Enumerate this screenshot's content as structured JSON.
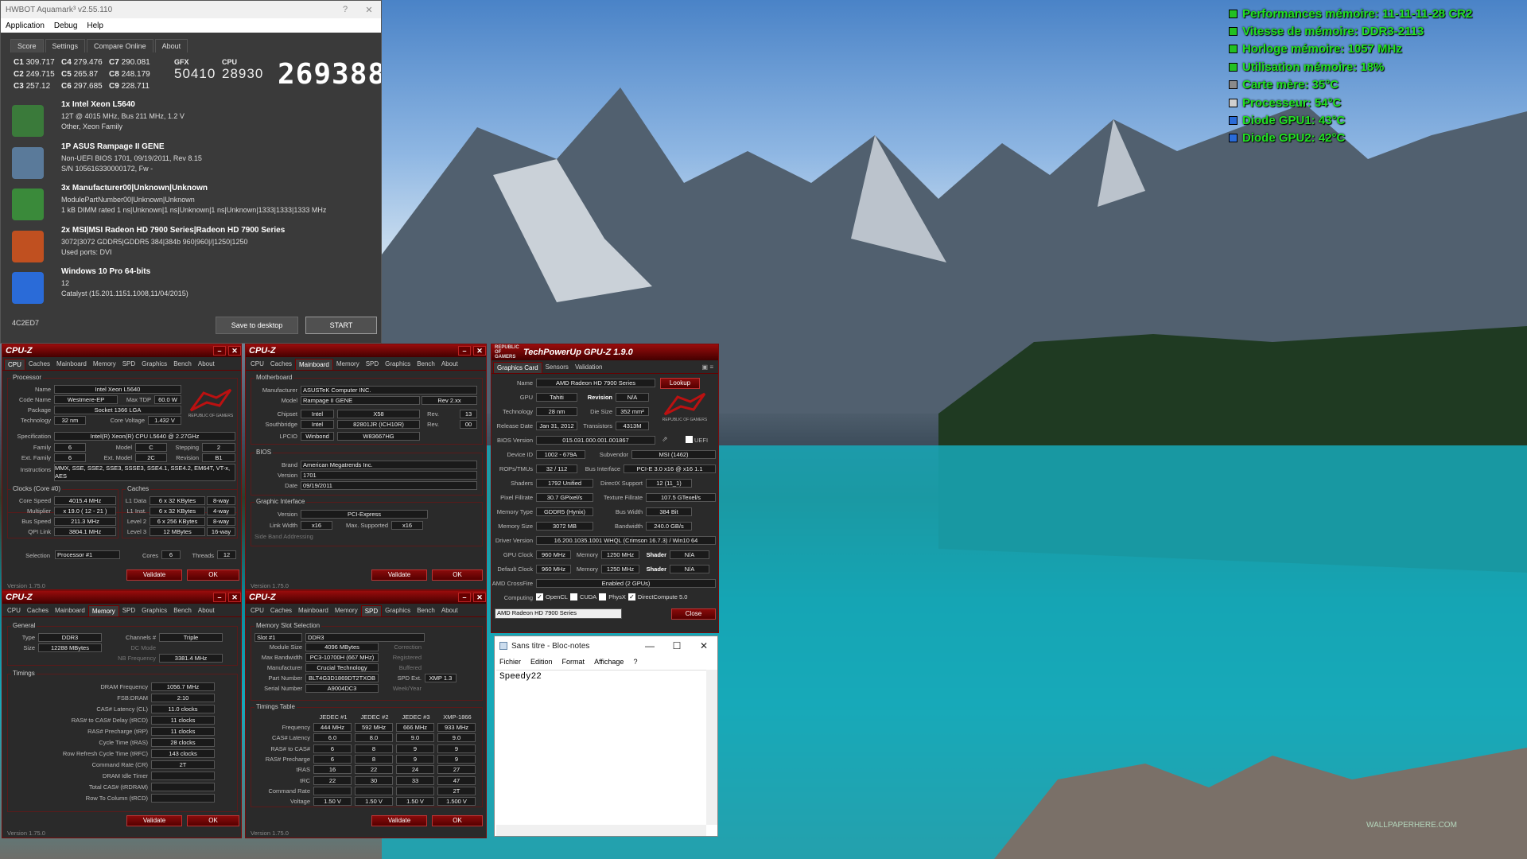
{
  "osd": {
    "lines": [
      {
        "text": "Performances mémoire: 11-11-11-28 CR2",
        "icon_color": "#22c022"
      },
      {
        "text": "Vitesse de mémoire: DDR3-2113",
        "icon_color": "#22c022"
      },
      {
        "text": "Horloge mémoire: 1057 MHz",
        "icon_color": "#22c022"
      },
      {
        "text": "Utilisation mémoire: 18%",
        "icon_color": "#22c022"
      },
      {
        "text": "Carte mère: 35°C",
        "icon_color": "#8a8a8a"
      },
      {
        "text": "Processeur: 54°C",
        "icon_color": "#cfcfcf"
      },
      {
        "text": "Diode GPU1: 43°C",
        "icon_color": "#2a6bd8"
      },
      {
        "text": "Diode GPU2: 42°C",
        "icon_color": "#2a6bd8"
      }
    ]
  },
  "aquamark": {
    "title": "HWBOT Aquamark³ v2.55.110",
    "menu": [
      "Application",
      "Debug",
      "Help"
    ],
    "tabs": [
      "Score",
      "Settings",
      "Compare Online",
      "About"
    ],
    "chapters": [
      {
        "label": "C1",
        "value": "309.717"
      },
      {
        "label": "C4",
        "value": "279.476"
      },
      {
        "label": "C7",
        "value": "290.081"
      },
      {
        "label": "C2",
        "value": "249.715"
      },
      {
        "label": "C5",
        "value": "265.87"
      },
      {
        "label": "C8",
        "value": "248.179"
      },
      {
        "label": "C3",
        "value": "257.12"
      },
      {
        "label": "C6",
        "value": "297.685"
      },
      {
        "label": "C9",
        "value": "228.711"
      }
    ],
    "gfx_label": "GFX",
    "gfx_value": "50410",
    "cpu_label": "CPU",
    "cpu_value": "28930",
    "total": "269388",
    "hardware": [
      {
        "title": "1x Intel Xeon      L5640",
        "lines": [
          "12T @ 4015 MHz, Bus 211 MHz, 1.2 V",
          "Other, Xeon Family"
        ],
        "icon": "cpu-icon",
        "color": "#3a7a3a"
      },
      {
        "title": "1P ASUS Rampage II GENE",
        "lines": [
          "Non-UEFI BIOS 1701, 09/19/2011, Rev 8.15",
          "S/N 105616330000172, Fw -"
        ],
        "icon": "motherboard-icon",
        "color": "#5a7a9a"
      },
      {
        "title": "3x Manufacturer00|Unknown|Unknown",
        "lines": [
          " ModulePartNumber00|Unknown|Unknown",
          "1 kB  DIMM rated 1 ns|Unknown|1 ns|Unknown|1 ns|Unknown|1333|1333|1333 MHz"
        ],
        "icon": "memory-icon",
        "color": "#3a8a3a"
      },
      {
        "title": "2x MSI|MSI Radeon HD 7900 Series|Radeon HD 7900 Series",
        "lines": [
          "3072|3072 GDDR5|GDDR5 384|384b 960|960|/|1250|1250",
          "Used ports: DVI"
        ],
        "icon": "gpu-icon",
        "color": "#c05020"
      },
      {
        "title": "Windows 10 Pro 64-bits",
        "lines": [
          "12",
          "Catalyst (15.201.1151.1008,11/04/2015)"
        ],
        "icon": "windows-icon",
        "color": "#2a6bd8"
      }
    ],
    "code": "4C2ED7",
    "save_label": "Save to desktop",
    "start_label": "START"
  },
  "cpuz_tabs": [
    "CPU",
    "Caches",
    "Mainboard",
    "Memory",
    "SPD",
    "Graphics",
    "Bench",
    "About"
  ],
  "cpuz_title": "CPU-Z",
  "cpuz_version": "Version 1.75.0",
  "validate_label": "Validate",
  "ok_label": "OK",
  "cpu": {
    "processor_group": "Processor",
    "name_l": "Name",
    "name": "Intel Xeon L5640",
    "codename_l": "Code Name",
    "codename": "Westmere-EP",
    "maxtdp_l": "Max TDP",
    "maxtdp": "60.0 W",
    "package_l": "Package",
    "package": "Socket 1366 LGA",
    "tech_l": "Technology",
    "tech": "32 nm",
    "cv_l": "Core Voltage",
    "cv": "1.432 V",
    "spec_l": "Specification",
    "spec": "Intel(R) Xeon(R) CPU          L5640  @ 2.27GHz",
    "family_l": "Family",
    "family": "6",
    "model_l": "Model",
    "model": "C",
    "stepping_l": "Stepping",
    "stepping": "2",
    "extfamily_l": "Ext. Family",
    "extfamily": "6",
    "extmodel_l": "Ext. Model",
    "extmodel": "2C",
    "revision_l": "Revision",
    "revision": "B1",
    "instr_l": "Instructions",
    "instr": "MMX, SSE, SSE2, SSE3, SSSE3, SSE4.1, SSE4.2, EM64T, VT-x, AES",
    "clocks_group": "Clocks (Core #0)",
    "corespeed_l": "Core Speed",
    "corespeed": "4015.4 MHz",
    "mult_l": "Multiplier",
    "mult": "x 19.0 ( 12 - 21 )",
    "busspeed_l": "Bus Speed",
    "busspeed": "211.3 MHz",
    "qpi_l": "QPI Link",
    "qpi": "3804.1 MHz",
    "caches_group": "Caches",
    "l1d_l": "L1 Data",
    "l1d": "6 x 32 KBytes",
    "l1d_w": "8-way",
    "l1i_l": "L1 Inst.",
    "l1i": "6 x 32 KBytes",
    "l1i_w": "4-way",
    "l2_l": "Level 2",
    "l2": "6 x 256 KBytes",
    "l2_w": "8-way",
    "l3_l": "Level 3",
    "l3": "12 MBytes",
    "l3_w": "16-way",
    "selection_l": "Selection",
    "selection": "Processor #1",
    "cores_l": "Cores",
    "cores": "6",
    "threads_l": "Threads",
    "threads": "12"
  },
  "mainboard": {
    "mb_group": "Motherboard",
    "manu_l": "Manufacturer",
    "manu": "ASUSTeK Computer INC.",
    "model_l": "Model",
    "model": "Rampage II GENE",
    "rev": "Rev 2.xx",
    "chipset_l": "Chipset",
    "chipset_v": "Intel",
    "chipset": "X58",
    "chipset_rev_l": "Rev.",
    "chipset_rev": "13",
    "south_l": "Southbridge",
    "south_v": "Intel",
    "south": "82801JR (ICH10R)",
    "south_rev_l": "Rev.",
    "south_rev": "00",
    "lpcio_l": "LPCIO",
    "lpcio_v": "Winbond",
    "lpcio": "W83667HG",
    "bios_group": "BIOS",
    "brand_l": "Brand",
    "brand": "American Megatrends Inc.",
    "ver_l": "Version",
    "ver": "1701",
    "date_l": "Date",
    "date": "09/19/2011",
    "gi_group": "Graphic Interface",
    "giver_l": "Version",
    "giver": "PCI-Express",
    "lw_l": "Link Width",
    "lw": "x16",
    "ms_l": "Max. Supported",
    "ms": "x16",
    "sba_l": "Side Band Addressing"
  },
  "memory": {
    "general_group": "General",
    "type_l": "Type",
    "type": "DDR3",
    "ch_l": "Channels #",
    "ch": "Triple",
    "size_l": "Size",
    "size": "12288 MBytes",
    "dc_l": "DC Mode",
    "nb_l": "NB Frequency",
    "nb": "3381.4 MHz",
    "timings_group": "Timings",
    "rows": [
      {
        "label": "DRAM Frequency",
        "value": "1056.7 MHz"
      },
      {
        "label": "FSB:DRAM",
        "value": "2:10"
      },
      {
        "label": "CAS# Latency (CL)",
        "value": "11.0 clocks"
      },
      {
        "label": "RAS# to CAS# Delay (tRCD)",
        "value": "11 clocks"
      },
      {
        "label": "RAS# Precharge (tRP)",
        "value": "11 clocks"
      },
      {
        "label": "Cycle Time (tRAS)",
        "value": "28 clocks"
      },
      {
        "label": "Row Refresh Cycle Time (tRFC)",
        "value": "143 clocks"
      },
      {
        "label": "Command Rate (CR)",
        "value": "2T"
      },
      {
        "label": "DRAM Idle Timer",
        "value": ""
      },
      {
        "label": "Total CAS# (tRDRAM)",
        "value": ""
      },
      {
        "label": "Row To Column (tRCD)",
        "value": ""
      }
    ]
  },
  "spd": {
    "slot_group": "Memory Slot Selection",
    "slot": "Slot #1",
    "type": "DDR3",
    "modsize_l": "Module Size",
    "modsize": "4096 MBytes",
    "maxbw_l": "Max Bandwidth",
    "maxbw": "PC3-10700H (667 MHz)",
    "manu_l": "Manufacturer",
    "manu": "Crucial Technology",
    "part_l": "Part Number",
    "part": "BLT4G3D1869DT2TXOB",
    "serial_l": "Serial Number",
    "serial": "A9004DC3",
    "corr_l": "Correction",
    "reg_l": "Registered",
    "buf_l": "Buffered",
    "spdext_l": "SPD Ext.",
    "spdext": "XMP 1.3",
    "wy_l": "Week/Year",
    "tt_group": "Timings Table",
    "cols": [
      "JEDEC #1",
      "JEDEC #2",
      "JEDEC #3",
      "XMP-1866"
    ],
    "rows": [
      {
        "label": "Frequency",
        "vals": [
          "444 MHz",
          "592 MHz",
          "666 MHz",
          "933 MHz"
        ]
      },
      {
        "label": "CAS# Latency",
        "vals": [
          "6.0",
          "8.0",
          "9.0",
          "9.0"
        ]
      },
      {
        "label": "RAS# to CAS#",
        "vals": [
          "6",
          "8",
          "9",
          "9"
        ]
      },
      {
        "label": "RAS# Precharge",
        "vals": [
          "6",
          "8",
          "9",
          "9"
        ]
      },
      {
        "label": "tRAS",
        "vals": [
          "16",
          "22",
          "24",
          "27"
        ]
      },
      {
        "label": "tRC",
        "vals": [
          "22",
          "30",
          "33",
          "47"
        ]
      },
      {
        "label": "Command Rate",
        "vals": [
          "",
          "",
          "",
          "2T"
        ]
      },
      {
        "label": "Voltage",
        "vals": [
          "1.50 V",
          "1.50 V",
          "1.50 V",
          "1.500 V"
        ]
      }
    ]
  },
  "gpuz": {
    "title": "TechPowerUp GPU-Z 1.9.0",
    "tabs": [
      "Graphics Card",
      "Sensors",
      "Validation"
    ],
    "lookup": "Lookup",
    "name_l": "Name",
    "name": "AMD Radeon HD 7900 Series",
    "gpu_l": "GPU",
    "gpu": "Tahiti",
    "revision_l": "Revision",
    "revision": "N/A",
    "tech_l": "Technology",
    "tech": "28 nm",
    "die_l": "Die Size",
    "die": "352 mm²",
    "rel_l": "Release Date",
    "rel": "Jan 31, 2012",
    "trans_l": "Transistors",
    "trans": "4313M",
    "bios_l": "BIOS Version",
    "bios": "015.031.000.001.001867",
    "uefi_l": "UEFI",
    "devid_l": "Device ID",
    "devid": "1002 - 679A",
    "subv_l": "Subvendor",
    "subv": "MSI (1462)",
    "rops_l": "ROPs/TMUs",
    "rops": "32 / 112",
    "bus_l": "Bus Interface",
    "bus": "PCI-E 3.0 x16 @ x16 1.1",
    "shaders_l": "Shaders",
    "shaders": "1792 Unified",
    "dx_l": "DirectX Support",
    "dx": "12 (11_1)",
    "pix_l": "Pixel Fillrate",
    "pix": "30.7 GPixel/s",
    "tex_l": "Texture Fillrate",
    "tex": "107.5 GTexel/s",
    "memtype_l": "Memory Type",
    "memtype": "GDDR5 (Hynix)",
    "busw_l": "Bus Width",
    "busw": "384 Bit",
    "memsize_l": "Memory Size",
    "memsize": "3072 MB",
    "bw_l": "Bandwidth",
    "bw": "240.0 GB/s",
    "drv_l": "Driver Version",
    "drv": "16.200.1035.1001 WHQL (Crimson 16.7.3) / Win10 64",
    "gclk_l": "GPU Clock",
    "gclk": "960 MHz",
    "mclk_l": "Memory",
    "mclk": "1250 MHz",
    "shd_l": "Shader",
    "shd": "N/A",
    "dclk_l": "Default Clock",
    "dclk": "960 MHz",
    "dmclk_l": "Memory",
    "dmclk": "1250 MHz",
    "dshd_l": "Shader",
    "dshd": "N/A",
    "cf_l": "AMD CrossFire",
    "cf": "Enabled (2 GPUs)",
    "comp_l": "Computing",
    "opencl": "OpenCL",
    "cuda": "CUDA",
    "physx": "PhysX",
    "dc": "DirectCompute 5.0",
    "select": "AMD Radeon HD 7900 Series",
    "close": "Close",
    "rog_small": "REPUBLIC OF GAMERS"
  },
  "notepad": {
    "title": "Sans titre - Bloc-notes",
    "menu": [
      "Fichier",
      "Edition",
      "Format",
      "Affichage",
      "?"
    ],
    "text": "Speedy22"
  },
  "watermark": "WALLPAPERHERE.COM"
}
